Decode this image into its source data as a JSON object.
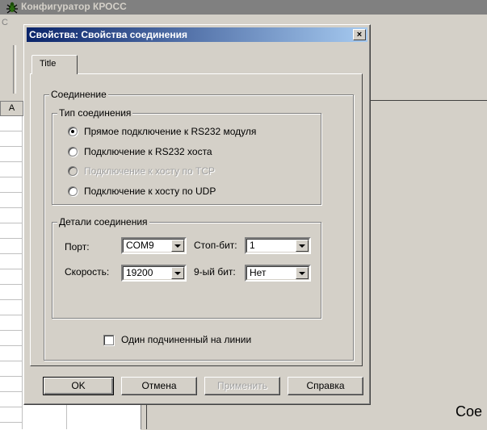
{
  "background": {
    "title": "Конфигуратор КРОСС",
    "menu_first": "С",
    "grid_header": "А",
    "right_text": "Сое"
  },
  "dialog": {
    "title": "Свойства: Свойства соединения",
    "close": "×",
    "tab_label": "Title",
    "group_connection": "Соединение",
    "group_type": "Тип соединения",
    "radios": [
      {
        "label": "Прямое подключение к RS232 модуля",
        "checked": true,
        "enabled": true
      },
      {
        "label": "Подключение к RS232 хоста",
        "checked": false,
        "enabled": true
      },
      {
        "label": "Подключение к хосту по TCP",
        "checked": false,
        "enabled": false
      },
      {
        "label": "Подключение к хосту по UDP",
        "checked": false,
        "enabled": true
      }
    ],
    "group_details": "Детали соединения",
    "port_label": "Порт:",
    "port_value": "COM9",
    "stopbits_label": "Стоп-бит:",
    "stopbits_value": "1",
    "speed_label": "Скорость:",
    "speed_value": "19200",
    "ninthbit_label": "9-ый бит:",
    "ninthbit_value": "Нет",
    "checkbox_label": "Один подчиненный на линии",
    "buttons": {
      "ok": "OK",
      "cancel": "Отмена",
      "apply": "Применить",
      "help": "Справка"
    }
  }
}
